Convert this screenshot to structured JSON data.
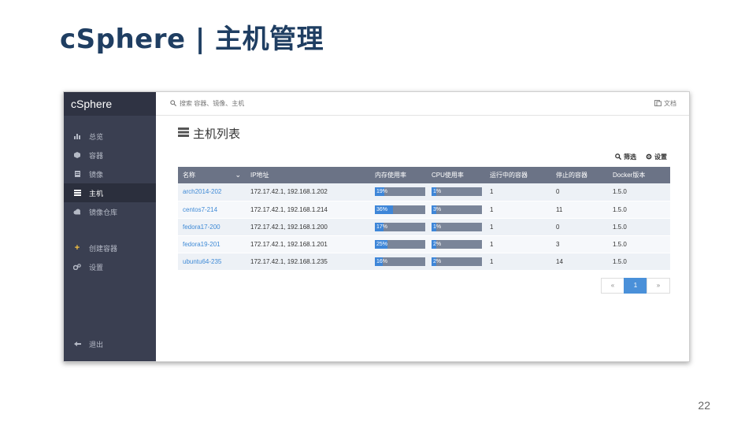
{
  "slide": {
    "title": "cSphere | 主机管理",
    "page_number": "22"
  },
  "sidebar": {
    "brand": "cSphere",
    "items": [
      {
        "label": "总览",
        "icon": "bar-chart-icon"
      },
      {
        "label": "容器",
        "icon": "cube-icon"
      },
      {
        "label": "镜像",
        "icon": "file-icon"
      },
      {
        "label": "主机",
        "icon": "server-icon",
        "active": true
      },
      {
        "label": "镜像仓库",
        "icon": "cloud-icon"
      }
    ],
    "actions": [
      {
        "label": "创建容器",
        "icon": "plus-icon"
      },
      {
        "label": "设置",
        "icon": "gears-icon"
      }
    ],
    "logout": "退出"
  },
  "topbar": {
    "search_placeholder": "搜索 容器、镜像、主机",
    "docs_label": "文档"
  },
  "page": {
    "heading": "主机列表",
    "filter_label": "筛选",
    "settings_label": "设置"
  },
  "table": {
    "columns": [
      "名称",
      "IP地址",
      "内存使用率",
      "CPU使用率",
      "运行中的容器",
      "停止的容器",
      "Docker版本"
    ],
    "rows": [
      {
        "name": "arch2014-202",
        "ip": "172.17.42.1, 192.168.1.202",
        "mem": "19%",
        "mem_value": 19,
        "cpu": "1%",
        "cpu_value": 1,
        "running": "1",
        "stopped": "0",
        "docker": "1.5.0"
      },
      {
        "name": "centos7-214",
        "ip": "172.17.42.1, 192.168.1.214",
        "mem": "36%",
        "mem_value": 36,
        "cpu": "3%",
        "cpu_value": 3,
        "running": "1",
        "stopped": "11",
        "docker": "1.5.0"
      },
      {
        "name": "fedora17-200",
        "ip": "172.17.42.1, 192.168.1.200",
        "mem": "17%",
        "mem_value": 17,
        "cpu": "1%",
        "cpu_value": 1,
        "running": "1",
        "stopped": "0",
        "docker": "1.5.0"
      },
      {
        "name": "fedora19-201",
        "ip": "172.17.42.1, 192.168.1.201",
        "mem": "25%",
        "mem_value": 25,
        "cpu": "2%",
        "cpu_value": 2,
        "running": "1",
        "stopped": "3",
        "docker": "1.5.0"
      },
      {
        "name": "ubuntu64-235",
        "ip": "172.17.42.1, 192.168.1.235",
        "mem": "16%",
        "mem_value": 16,
        "cpu": "2%",
        "cpu_value": 2,
        "running": "1",
        "stopped": "14",
        "docker": "1.5.0"
      }
    ]
  },
  "pagination": {
    "prev": "«",
    "current": "1",
    "next": "»"
  },
  "colors": {
    "sidebar_bg": "#3a3f51",
    "header_bg": "#6b7386",
    "accent": "#3e86d8",
    "title": "#1f3e62"
  }
}
